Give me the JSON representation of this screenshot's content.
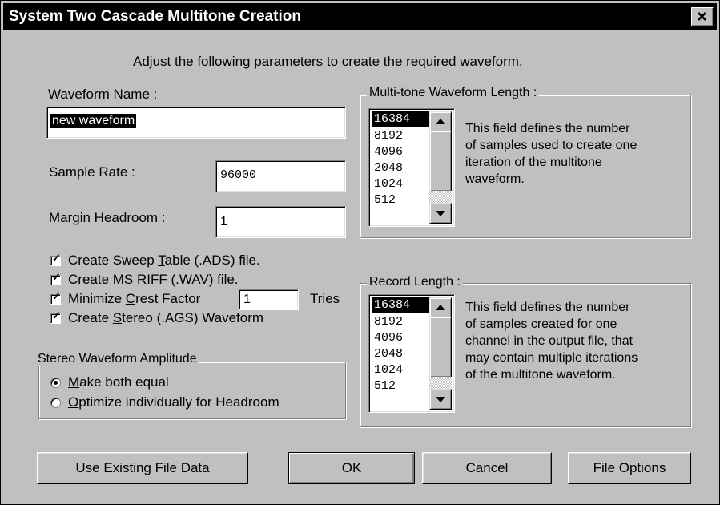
{
  "window": {
    "title": "System Two Cascade Multitone Creation"
  },
  "instructions": "Adjust the following parameters to create the required waveform.",
  "waveform_name": {
    "label": "Waveform Name :",
    "value": "new waveform"
  },
  "sample_rate": {
    "label": "Sample Rate :",
    "value": "96000"
  },
  "margin_headroom": {
    "label": "Margin Headroom :",
    "value": "1"
  },
  "checkboxes": [
    {
      "pre": "Create Sweep ",
      "acc": "T",
      "post": "able (.ADS) file.",
      "checked": true
    },
    {
      "pre": "Create MS ",
      "acc": "R",
      "post": "IFF (.WAV) file.",
      "checked": true
    },
    {
      "pre": "Minimize ",
      "acc": "C",
      "post": "rest Factor",
      "checked": true
    },
    {
      "pre": "Create ",
      "acc": "S",
      "post": "tereo (.AGS) Waveform",
      "checked": true
    }
  ],
  "tries": {
    "value": "1",
    "label": "Tries"
  },
  "stereo_group": {
    "title": "Stereo Waveform Amplitude",
    "options": [
      {
        "acc": "M",
        "post": "ake both equal",
        "selected": true
      },
      {
        "acc": "O",
        "post": "ptimize individually for Headroom",
        "selected": false
      }
    ]
  },
  "multitone_group": {
    "title": "Multi-tone Waveform Length :",
    "items": [
      "16384",
      "8192",
      "4096",
      "2048",
      "1024",
      "512"
    ],
    "selected": "16384",
    "description": [
      "This field defines the number",
      "of samples used to create one",
      "iteration of the multitone",
      "waveform."
    ]
  },
  "record_group": {
    "title": "Record Length :",
    "items": [
      "16384",
      "8192",
      "4096",
      "2048",
      "1024",
      "512"
    ],
    "selected": "16384",
    "description": [
      "This field defines the number",
      "of samples created for one",
      "channel in the output file, that",
      "may contain multiple iterations",
      "of the multitone waveform."
    ]
  },
  "buttons": {
    "use_existing": "Use Existing File Data",
    "ok": "OK",
    "cancel": "Cancel",
    "file_options": "File Options"
  },
  "icons": {
    "close": "close-icon",
    "scroll_up": "arrow-up-icon",
    "scroll_down": "arrow-down-icon",
    "check": "checkmark-icon"
  }
}
